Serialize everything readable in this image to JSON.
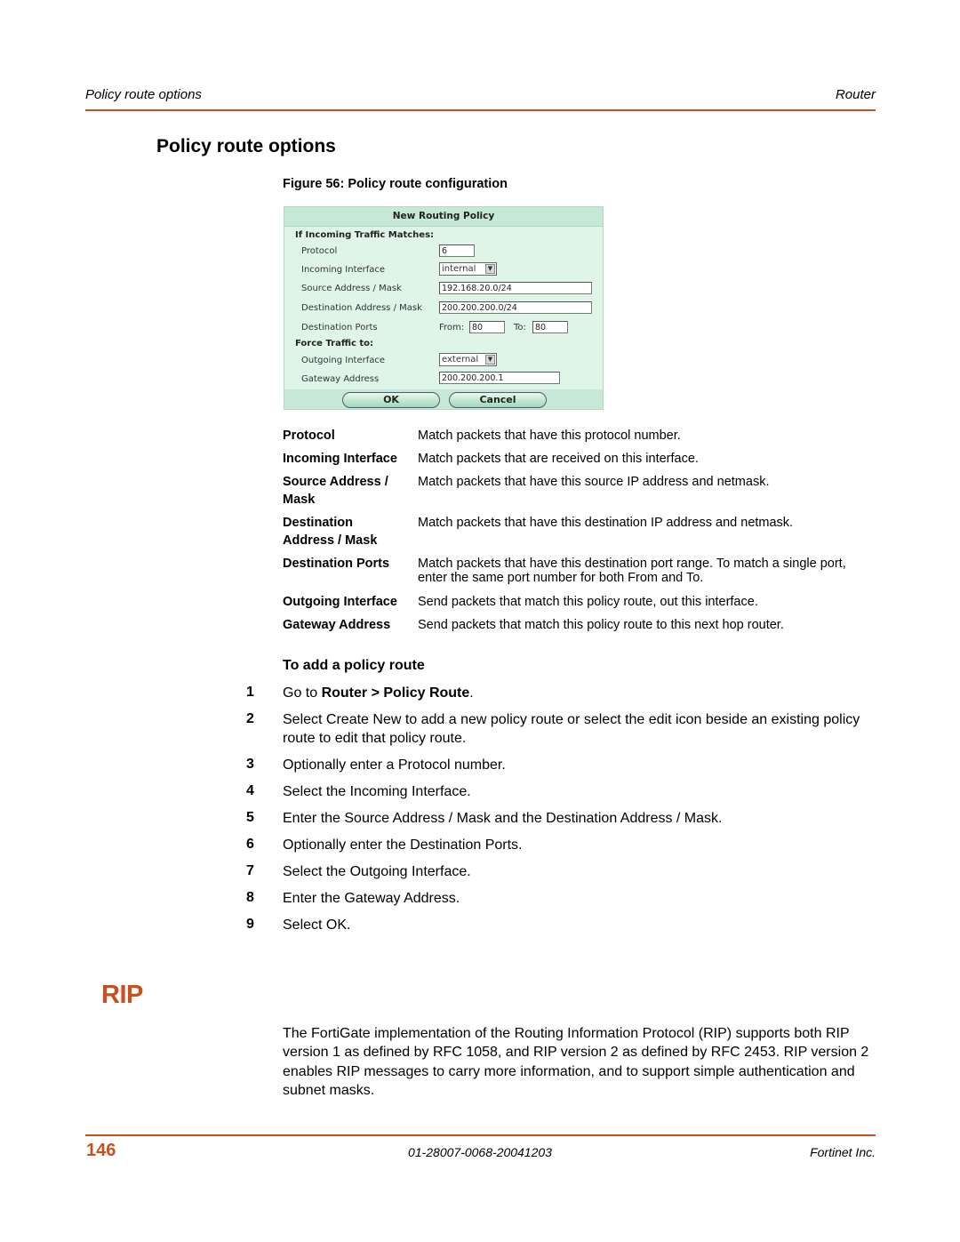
{
  "header": {
    "section": "Policy route options",
    "chapter": "Router"
  },
  "heading": "Policy route options",
  "figure": {
    "caption": "Figure 56: Policy route configuration",
    "dialog": {
      "title": "New Routing Policy",
      "section_match": "If Incoming Traffic Matches:",
      "section_force": "Force Traffic to:",
      "fields": {
        "protocol": {
          "label": "Protocol",
          "value": "6"
        },
        "incoming_interface": {
          "label": "Incoming Interface",
          "value": "internal"
        },
        "source_address": {
          "label": "Source Address / Mask",
          "value": "192.168.20.0/24"
        },
        "destination_address": {
          "label": "Destination Address / Mask",
          "value": "200.200.200.0/24"
        },
        "destination_ports": {
          "label": "Destination Ports",
          "from_label": "From:",
          "from_value": "80",
          "to_label": "To:",
          "to_value": "80"
        },
        "outgoing_interface": {
          "label": "Outgoing Interface",
          "value": "external"
        },
        "gateway_address": {
          "label": "Gateway Address",
          "value": "200.200.200.1"
        }
      },
      "ok_label": "OK",
      "cancel_label": "Cancel"
    }
  },
  "definitions": [
    {
      "term": "Protocol",
      "desc": "Match packets that have this protocol number."
    },
    {
      "term": "Incoming Interface",
      "desc": "Match packets that are received on this interface."
    },
    {
      "term": "Source Address / Mask",
      "desc": "Match packets that have this source IP address and netmask."
    },
    {
      "term": "Destination Address / Mask",
      "desc": "Match packets that have this destination IP address and netmask."
    },
    {
      "term": "Destination Ports",
      "desc": "Match packets that have this destination port range. To match a single port, enter the same port number for both From and To."
    },
    {
      "term": "Outgoing Interface",
      "desc": "Send packets that match this policy route, out this interface."
    },
    {
      "term": "Gateway Address",
      "desc": "Send packets that match this policy route to this next hop router."
    }
  ],
  "procedure": {
    "title": "To add a policy route",
    "step1_prefix": "Go to ",
    "step1_bold": "Router > Policy Route",
    "step1_suffix": ".",
    "steps": [
      {
        "num": "1"
      },
      {
        "num": "2",
        "text": "Select Create New to add a new policy route or select the edit icon beside an existing policy route to edit that policy route."
      },
      {
        "num": "3",
        "text": "Optionally enter a Protocol number."
      },
      {
        "num": "4",
        "text": "Select the Incoming Interface."
      },
      {
        "num": "5",
        "text": "Enter the Source Address / Mask and the Destination Address / Mask."
      },
      {
        "num": "6",
        "text": "Optionally enter the Destination Ports."
      },
      {
        "num": "7",
        "text": "Select the Outgoing Interface."
      },
      {
        "num": "8",
        "text": "Enter the Gateway Address."
      },
      {
        "num": "9",
        "text": "Select OK."
      }
    ]
  },
  "rip": {
    "heading": "RIP",
    "paragraph": "The FortiGate implementation of the Routing Information Protocol (RIP) supports both RIP version 1 as defined by RFC 1058, and RIP version 2 as defined by RFC 2453. RIP version 2 enables RIP messages to carry more information, and to support simple authentication and subnet masks."
  },
  "footer": {
    "page_number": "146",
    "doc_id": "01-28007-0068-20041203",
    "company": "Fortinet Inc."
  },
  "colors": {
    "accent": "#c8501e",
    "panel_bg": "#dff5e8",
    "panel_header": "#c6e8d6"
  }
}
